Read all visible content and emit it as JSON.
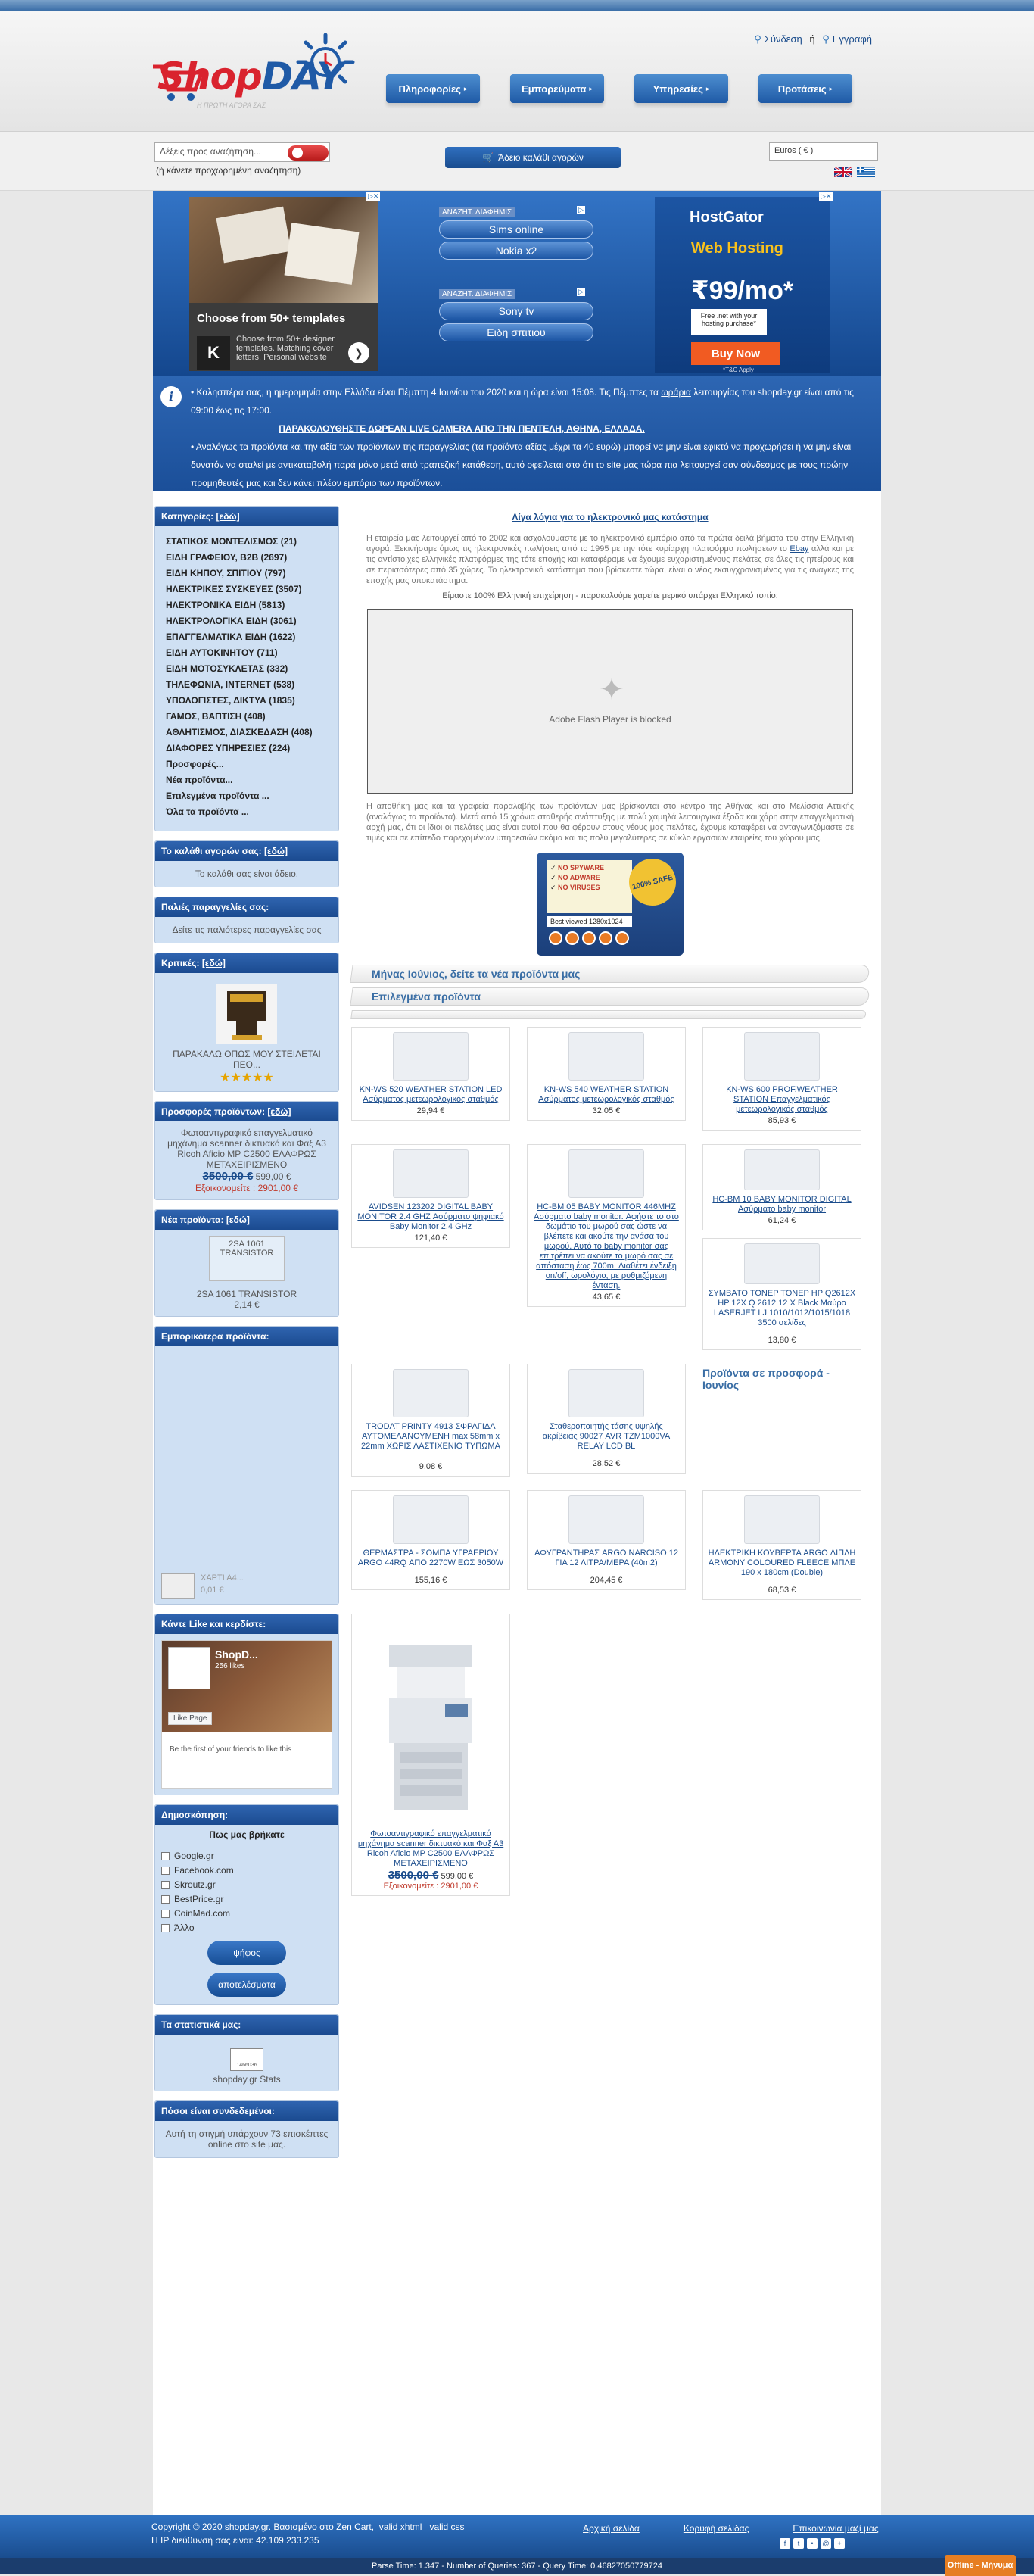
{
  "header": {
    "brand_shop": "Shop",
    "brand_day": "DAY",
    "brand_slogan": "Η ΠΡΩΤΗ ΑΓΟΡΑ ΣΑΣ",
    "login": "Σύνδεση",
    "or": "ή",
    "register": "Εγγραφή",
    "nav": [
      "Πληροφορίες",
      "Εμπορεύματα",
      "Υπηρεσίες",
      "Προτάσεις"
    ]
  },
  "search": {
    "placeholder": "Λέξεις προς αναζήτηση...",
    "hint": "(ή κάνετε προχωρημένη αναζήτηση)",
    "cart_label": "Άδειο καλάθι αγορών",
    "currency": "Euros ( € )"
  },
  "ads": {
    "templates_title": "Choose from 50+ templates",
    "templates_text": "Choose from 50+ designer templates. Matching cover letters. Personal website",
    "templates_letter": "K",
    "search_label": "ΑΝΑΖΗΤ. ΔΙΑΦΗΜΙΣ",
    "search_group1": [
      "Sims online",
      "Nokia x2"
    ],
    "search_group2": [
      "Sony tv",
      "Ειδη σπιτιου"
    ],
    "hg_brand": "HostGator",
    "hg_web": "Web Hosting",
    "hg_price": "₹99/mo*",
    "hg_net": "Free .net with your hosting purchase*",
    "hg_buy": "Buy Now",
    "hg_tc": "*T&C Apply"
  },
  "notice": {
    "line1_a": "Καλησπέρα σας, η ημερομηνία στην Ελλάδα είναι Πέμπτη 4 Ιουνίου του 2020 και η ώρα είναι 15:08. Τις Πέμπτες τα ",
    "line1_link": "ωράρια",
    "line1_b": " λειτουργίας του shopday.gr είναι από τις 09:00 έως τις 17:00.",
    "line2": "ΠΑΡΑΚΟΛΟΥΘΗΣΤΕ ΔΩΡΕΑΝ LIVE CAMERA ΑΠΟ ΤΗΝ ΠΕΝΤΕΛΗ, ΑΘΗΝΑ, ΕΛΛΑΔΑ.",
    "line3": "Αναλόγως τα προϊόντα και την αξία των προϊόντων της παραγγελίας (τα προϊόντα αξίας μέχρι τα 40 ευρώ) μπορεί να μην είναι εφικτό να προχωρήσει ή να μην είναι δυνατόν να σταλεί με αντικαταβολή παρά μόνο μετά από τραπεζική κατάθεση, αυτό οφείλεται στο ότι το site μας τώρα πια λειτουργεί σαν σύνδεσμος με τους πρώην προμηθευτές μας και δεν κάνει πλέον εμπόριο των προϊόντων."
  },
  "sidebar": {
    "categories_title": "Κατηγορίες:",
    "edit_link": "[εδώ]",
    "categories": [
      "ΣΤΑΤΙΚΟΣ ΜΟΝΤΕΛΙΣΜΟΣ (21)",
      "ΕΙΔΗ ΓΡΑΦΕΙΟΥ, B2B (2697)",
      "ΕΙΔΗ ΚΗΠΟΥ, ΣΠΙΤΙΟΥ (797)",
      "ΗΛΕΚΤΡΙΚΕΣ ΣΥΣΚΕΥΕΣ (3507)",
      "ΗΛΕΚΤΡΟΝΙΚΑ ΕΙΔΗ (5813)",
      "ΗΛΕΚΤΡΟΛΟΓΙΚΑ ΕΙΔΗ (3061)",
      "ΕΠΑΓΓΕΛΜΑΤΙΚΑ ΕΙΔΗ (1622)",
      "ΕΙΔΗ ΑΥΤΟΚΙΝΗΤΟΥ (711)",
      "ΕΙΔΗ ΜΟΤΟΣΥΚΛΕΤΑΣ (332)",
      "ΤΗΛΕΦΩΝΙΑ, INTERNET (538)",
      "ΥΠΟΛΟΓΙΣΤΕΣ, ΔΙΚΤΥΑ (1835)",
      "ΓΑΜΟΣ, ΒΑΠΤΙΣΗ (408)",
      "ΑΘΛΗΤΙΣΜΟΣ, ΔΙΑΣΚΕΔΑΣΗ (408)",
      "ΔΙΑΦΟΡΕΣ ΥΠΗΡΕΣΙΕΣ (224)",
      "Προσφορές...",
      "Νέα προϊόντα...",
      "Επιλεγμένα προϊόντα ...",
      "Όλα τα προϊόντα ..."
    ],
    "cart_title": "Το καλάθι αγορών σας:",
    "cart_empty": "Το καλάθι σας είναι άδειο.",
    "orders_title": "Παλιές παραγγελίες σας:",
    "orders_text": "Δείτε τις παλιότερες παραγγελίες σας",
    "reviews_title": "Κριτικές:",
    "review_text": "ΠΑΡΑΚΑΛΩ ΟΠΩΣ ΜΟΥ ΣΤΕΙΛΕΤΑΙ ΠΕΟ...",
    "review_stars": "★★★★★",
    "offers_title": "Προσφορές προϊόντων:",
    "offer_text": "Φωτοαντιγραφικό επαγγελματικό μηχάνημα scanner δικτυακό και Φαξ Α3 Ricoh Aficio MP C2500 ΕΛΑΦΡΩΣ ΜΕΤΑΧΕΙΡΙΣΜΕΝΟ",
    "offer_old": "3500,00 €",
    "offer_new": "599,00 €",
    "offer_save": "Εξοικονομείτε : 2901,00 €",
    "new_title": "Νέα προϊόντα:",
    "new_img_alt": "2SA 1061 TRANSISTOR",
    "new_name": "2SA 1061 TRANSISTOR",
    "new_price": "2,14 €",
    "featured_title": "Εμπορικότερα προϊόντα:",
    "featured_name": "ΧΑΡΤΙ Α4...",
    "featured_price": "0,01 €",
    "fb_title": "Κάντε Like και κερδίστε:",
    "fb_name": "ShopD...",
    "fb_likes": "256 likes",
    "fb_like_btn": "Like Page",
    "fb_note": "Be the first of your friends to like this",
    "poll_title": "Δημοσκόπηση:",
    "poll_q": "Πως μας βρήκατε",
    "poll_options": [
      "Google.gr",
      "Facebook.com",
      "Skroutz.gr",
      "BestPrice.gr",
      "CoinMad.com",
      "Άλλο"
    ],
    "poll_vote": "ψήφος",
    "poll_results": "αποτελέσματα",
    "stats_title": "Τα στατιστικά μας:",
    "stats_counter": "1466036",
    "stats_link": "shopday.gr Stats",
    "online_title": "Πόσοι είναι συνδεδεμένοι:",
    "online_text": "Αυτή τη στιγμή υπάρχουν 73 επισκέπτες online στο site μας."
  },
  "center": {
    "title": "Λίγα λόγια για το ηλεκτρονικό μας κατάστημα",
    "intro_a": "Η εταιρεία μας λειτουργεί από το 2002 και ασχολούμαστε με το ηλεκτρονικό εμπόριο από τα πρώτα δειλά βήματα του στην Ελληνική αγορά. Ξεκινήσαμε όμως τις ηλεκτρονικές πωλήσεις από το 1995 με την τότε κυρίαρχη πλατφόρμα πωλήσεων το ",
    "intro_link": "Ebay",
    "intro_b": " αλλά και με τις αντίστοιχες ελληνικές πλατφόρμες της τότε εποχής και καταφέραμε να έχουμε ευχαριστημένους πελάτες σε όλες τις ηπείρους και σε περισσότερες από 35 χώρες. Το ηλεκτρονικό κατάστημα που βρίσκεστε τώρα, είναι ο νέος εκσυγχρονισμένος για τις ανάγκες της εποχής μας υποκατάστημα.",
    "intro_c": "Είμαστε 100% Ελληνική επιχείρηση - παρακαλούμε χαρείτε μερικό υπάρχει Ελληνικό τοπίο:",
    "flash_msg": "Adobe Flash Player is blocked",
    "intro2": "Η αποθήκη μας και τα γραφεία παραλαβής των προϊόντων μας βρίσκονται στο κέντρο της Αθήνας και στο Μελίσσια Αττικής (αναλόγως τα προϊόντα). Μετά από 15 χρόνια σταθερής ανάπτυξης με πολύ χαμηλά λειτουργικά έξοδα και χάρη στην επαγγελματική αρχή μας, ότι οι ίδιοι οι πελάτες μας είναι αυτοί που θα φέρουν στους νέους μας πελάτες, έχουμε καταφέρει να ανταγωνιζόμαστε σε τιμές και σε επίπεδο παρεχομένων υπηρεσιών ακόμα και τις πολύ μεγαλύτερες σε κύκλο εργασιών εταιρείες του χώρου μας.",
    "badge_lines": [
      "NO SPYWARE",
      "NO ADWARE",
      "NO VIRUSES"
    ],
    "badge_star": "100% SAFE",
    "badge_res": "Best viewed 1280x1024",
    "bar1": "Μήνας Ιούνιος, δείτε τα νέα προϊόντα μας",
    "bar2": "Επιλεγμένα προϊόντα",
    "offers_heading": "Προϊόντα σε προσφορά - Ιουνίος",
    "products_row1": [
      {
        "name": "KN-WS 520 WEATHER STATION LED Ασύρματος μετεωρολογικός σταθμός",
        "price": "29,94 €"
      },
      {
        "name": "KN-WS 540 WEATHER STATION Ασύρματος μετεωρολογικός σταθμός",
        "price": "32,05 €"
      },
      {
        "name": "KN-WS 600 PROF.WEATHER STATION Επαγγελματικός μετεωρολογικός σταθμός",
        "price": "85,93 €"
      }
    ],
    "products_row2": [
      {
        "name": "AVIDSEN 123202 DIGITAL BABY MONITOR 2.4 GHZ Ασύρματο ψηφιακό Baby Monitor 2.4 GHz",
        "price": "121,40 €"
      },
      {
        "name": "HC-BM 05 BABY MONITOR 446MHZ Ασύρματο baby monitor. Αφήστε το στο δωμάτιο του μωρού σας ώστε να βλέπετε και ακούτε την ανάσα του μωρού. Αυτό το baby monitor σας επιτρέπει να ακούτε το μωρό σας σε απόσταση έως 700m. Διαθέτει ένδειξη on/off, ωρολόγιο, με ρυθμιζόμενη ένταση.",
        "price": "43,65 €"
      },
      {
        "name": "HC-BM 10 BABY MONITOR DIGITAL Ασύρματο baby monitor",
        "price": "61,24 €"
      }
    ],
    "product_toner": {
      "name": "ΣΥΜΒΑΤΟ ΤΟΝΕΡ ΤΟΝΕΡ HP Q2612X HP 12X Q 2612 12 X Black Μαύρο LASERJET LJ 1010/1012/1015/1018 3500 σελίδες",
      "price": "13,80 €"
    },
    "products_row4": [
      {
        "name": "TRODAT PRINTY 4913 ΣΦΡΑΓΙΔΑ ΑΥΤΟΜΕΛΑΝΟΥΜΕΝΗ max 58mm x 22mm ΧΩΡΙΣ ΛΑΣΤΙΧΕΝΙΟ ΤΥΠΩΜΑ",
        "price": "9,08 €"
      },
      {
        "name": "Σταθεροποιητής τάσης υψηλής ακρίβειας 90027 AVR ΤΖΜ1000VA RELAY LCD BL",
        "price": "28,52 €"
      }
    ],
    "products_row5": [
      {
        "name": "ΘΕΡΜΑΣΤΡΑ - ΣΟΜΠΑ ΥΓΡΑΕΡΙΟΥ ARGO 44RQ ΑΠΟ 2270W ΕΩΣ 3050W",
        "price": "155,16 €"
      },
      {
        "name": "ΑΦΥΓΡΑΝΤΗΡΑΣ ARGO NARCISO 12 ΓΙΑ 12 ΛΙΤΡΑ/ΜΕΡΑ (40m2)",
        "price": "204,45 €"
      },
      {
        "name": "ΗΛΕΚΤΡΙΚΗ ΚΟΥΒΕΡΤΑ ARGO ΔΙΠΛΗ ARMONY COLOURED FLEECE ΜΠΛΕ 190 x 180cm (Double)",
        "price": "68,53 €"
      }
    ],
    "product_copier": {
      "name": "Φωτοαντιγραφικό επαγγελματικό μηχάνημα scanner δικτυακό και Φαξ Α3 Ricoh Aficio MP C2500 ΕΛΑΦΡΩΣ ΜΕΤΑΧΕΙΡΙΣΜΕΝΟ",
      "old": "3500,00 €",
      "new": "599,00 €",
      "save": "Εξοικονομείτε : 2901,00 €"
    }
  },
  "footer": {
    "copyright_a": "Copyright © 2020 ",
    "site": "shopday.gr",
    "copyright_b": ". Βασισμένο στο ",
    "zencart": "Zen Cart",
    "xhtml": "valid xhtml",
    "css": "valid css",
    "ip": "Η IP διεύθυνσή σας είναι: 42.109.233.235",
    "home": "Αρχική σελίδα",
    "top": "Κορυφή σελίδας",
    "contact": "Επικοινωνία μαζί μας",
    "parse": "Parse Time: 1.347 - Number of Queries: 367 - Query Time: 0.46827050779724",
    "chat": "Offline - Μήνυμα"
  }
}
